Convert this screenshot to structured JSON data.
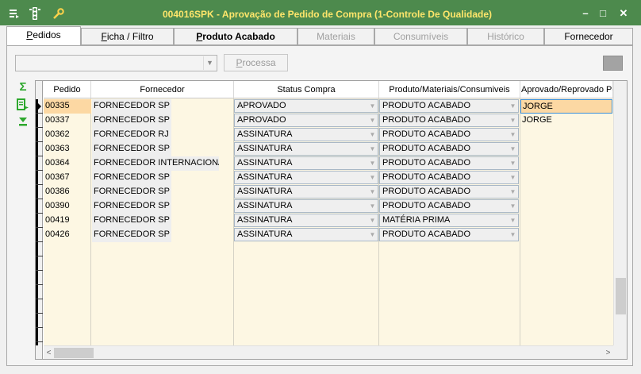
{
  "window": {
    "title": "004016SPK - Aprovação de Pedido de Compra (1-Controle De Qualidade)",
    "minimize": "–",
    "maximize": "□",
    "close": "✕",
    "icons": [
      "menu-icon",
      "traffic-light-icon",
      "wrench-icon"
    ],
    "title_color": "#ffe66b",
    "titlebar_color": "#4d8a4d"
  },
  "tabs": [
    {
      "label": "Pedidos",
      "active": true
    },
    {
      "label": "Ficha / Filtro",
      "active": false
    },
    {
      "label": "Produto Acabado",
      "active": false
    },
    {
      "label": "Materiais",
      "disabled": true
    },
    {
      "label": "Consumíveis",
      "disabled": true
    },
    {
      "label": "Histórico",
      "disabled": true
    },
    {
      "label": "Fornecedor",
      "active": false
    }
  ],
  "toolbar": {
    "combo_value": "",
    "process_label": "Processa"
  },
  "side_icons": [
    "sum-icon",
    "export-icon",
    "download-icon"
  ],
  "grid": {
    "columns": [
      "Pedido",
      "Fornecedor",
      "Status Compra",
      "Produto/Materiais/Consumiveis",
      "Aprovado/Reprovado Por"
    ],
    "rows": [
      {
        "pedido": "00335",
        "fornecedor": "FORNECEDOR SP",
        "status": "APROVADO",
        "produto": "PRODUTO ACABADO",
        "aprovado": "JORGE"
      },
      {
        "pedido": "00337",
        "fornecedor": "FORNECEDOR SP",
        "status": "APROVADO",
        "produto": "PRODUTO ACABADO",
        "aprovado": "JORGE"
      },
      {
        "pedido": "00362",
        "fornecedor": "FORNECEDOR RJ",
        "status": "ASSINATURA",
        "produto": "PRODUTO ACABADO",
        "aprovado": ""
      },
      {
        "pedido": "00363",
        "fornecedor": "FORNECEDOR SP",
        "status": "ASSINATURA",
        "produto": "PRODUTO ACABADO",
        "aprovado": ""
      },
      {
        "pedido": "00364",
        "fornecedor": "FORNECEDOR INTERNACIONAL",
        "status": "ASSINATURA",
        "produto": "PRODUTO ACABADO",
        "aprovado": ""
      },
      {
        "pedido": "00367",
        "fornecedor": "FORNECEDOR SP",
        "status": "ASSINATURA",
        "produto": "PRODUTO ACABADO",
        "aprovado": ""
      },
      {
        "pedido": "00386",
        "fornecedor": "FORNECEDOR SP",
        "status": "ASSINATURA",
        "produto": "PRODUTO ACABADO",
        "aprovado": ""
      },
      {
        "pedido": "00390",
        "fornecedor": "FORNECEDOR SP",
        "status": "ASSINATURA",
        "produto": "PRODUTO ACABADO",
        "aprovado": ""
      },
      {
        "pedido": "00419",
        "fornecedor": "FORNECEDOR SP",
        "status": "ASSINATURA",
        "produto": "MATÉRIA PRIMA",
        "aprovado": ""
      },
      {
        "pedido": "00426",
        "fornecedor": "FORNECEDOR SP",
        "status": "ASSINATURA",
        "produto": "PRODUTO ACABADO",
        "aprovado": ""
      }
    ],
    "selected_row": 0
  }
}
